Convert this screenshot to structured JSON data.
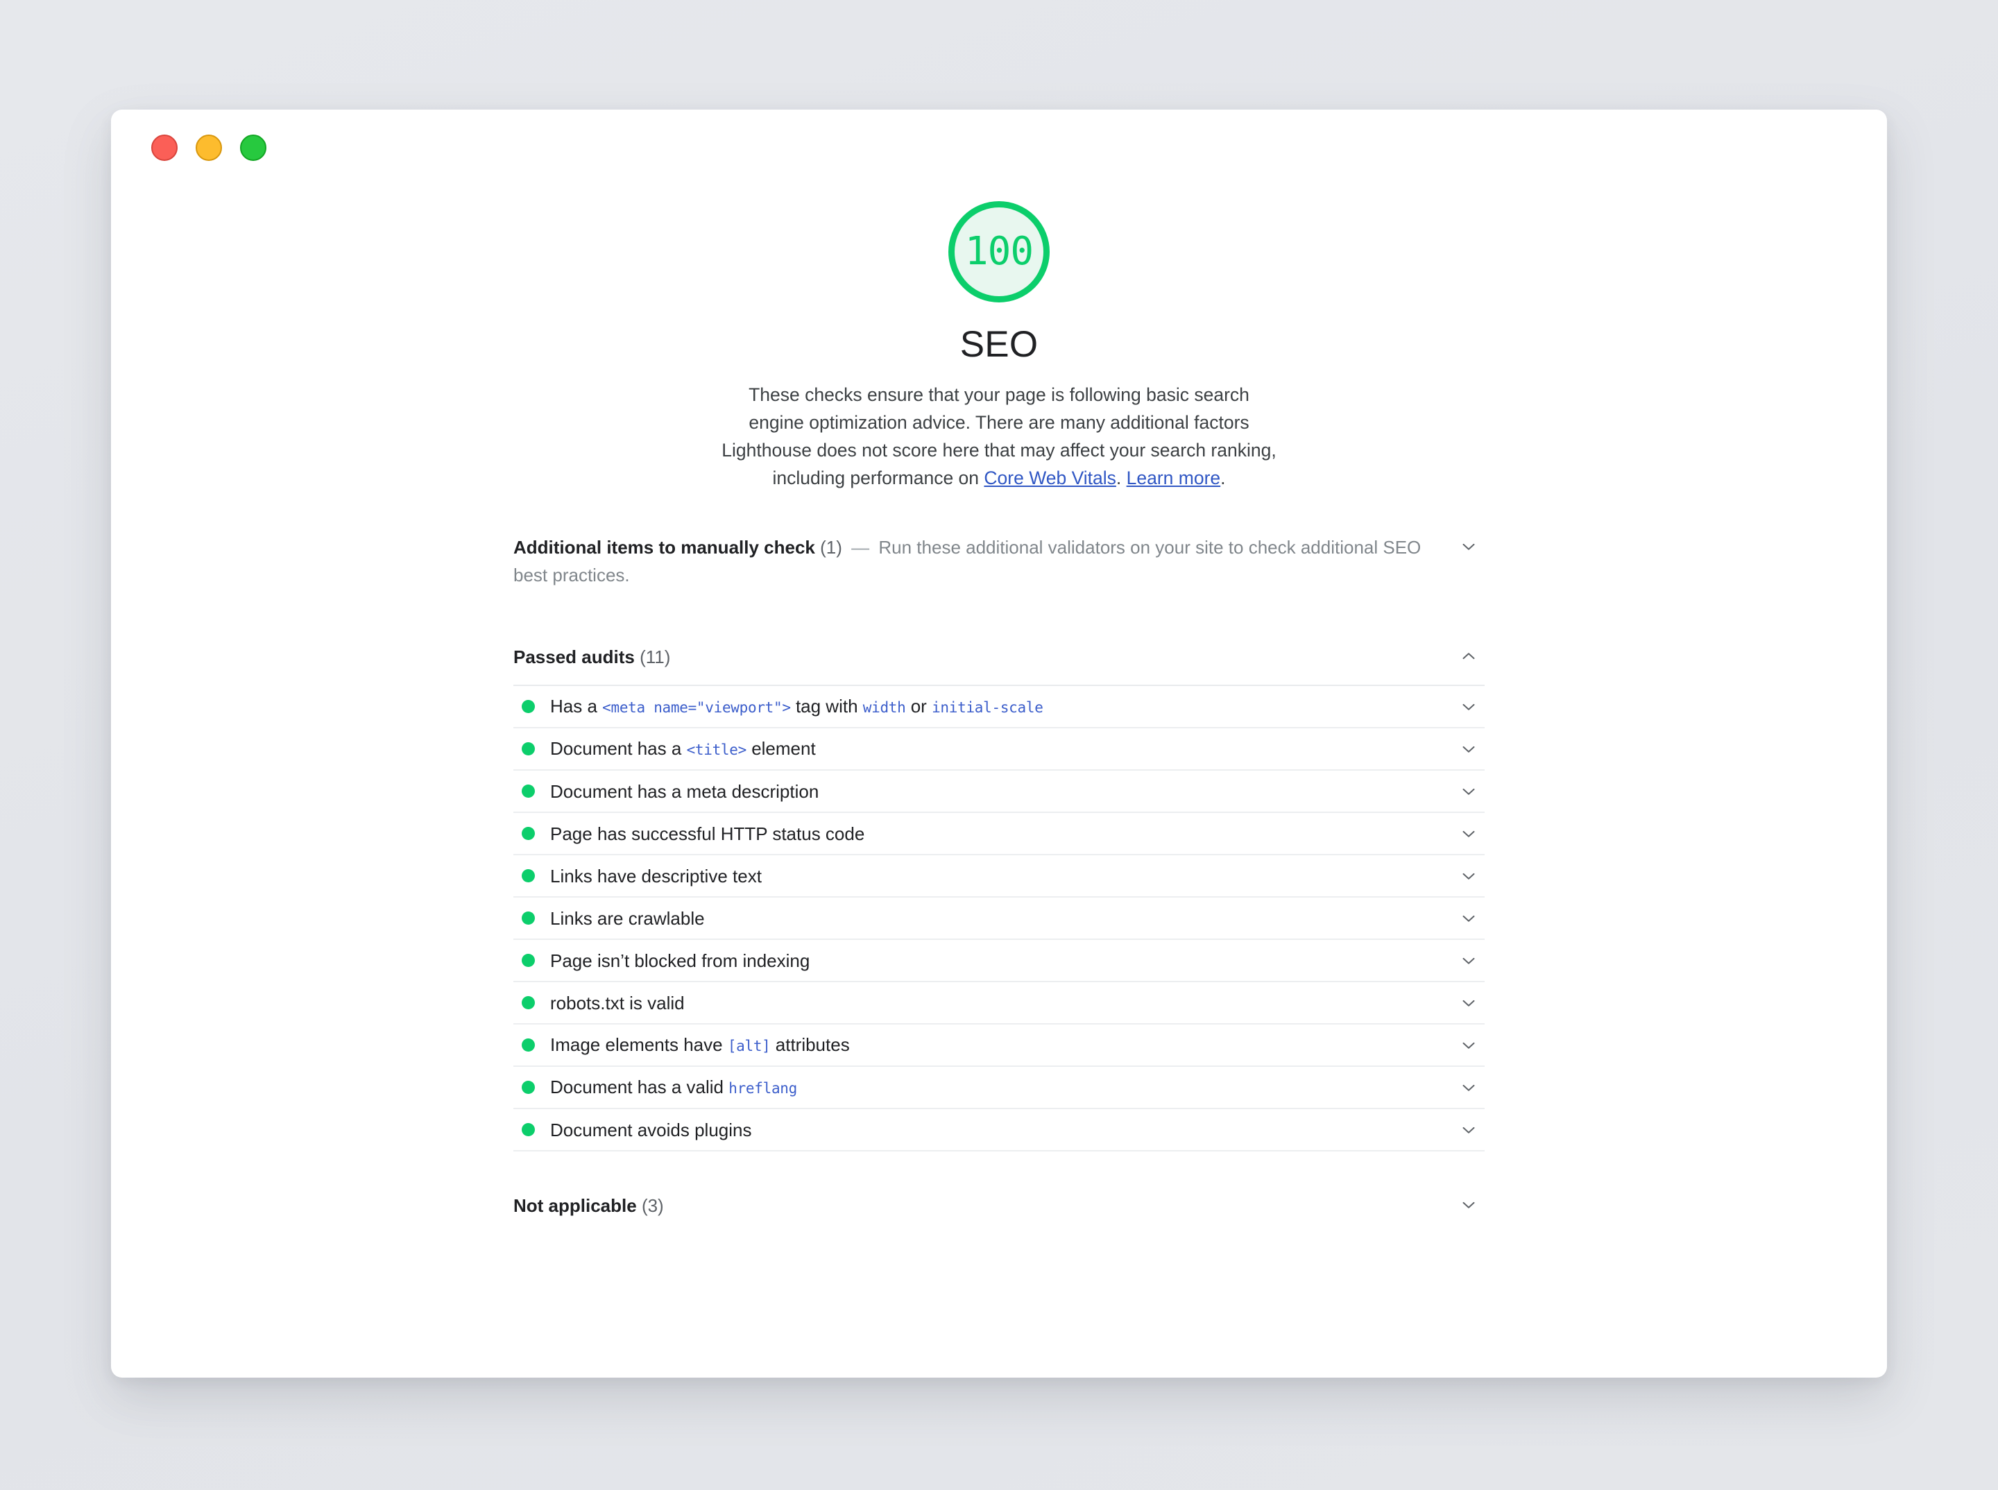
{
  "window": {
    "traffic_lights": [
      {
        "name": "close",
        "color": "#fb5f57"
      },
      {
        "name": "minimize",
        "color": "#fdbc2e"
      },
      {
        "name": "maximize",
        "color": "#27c93f"
      }
    ]
  },
  "report": {
    "score": "100",
    "category_title": "SEO",
    "description_parts": {
      "text_1": "These checks ensure that your page is following basic search engine optimization advice. There are many additional factors Lighthouse does not score here that may affect your search ranking, including performance on ",
      "link_1": "Core Web Vitals",
      "text_2": ". ",
      "link_2": "Learn more",
      "text_3": "."
    },
    "colors": {
      "pass_green": "#0cce6b",
      "gauge_fill": "#e8f7ef",
      "link_blue": "#3057c4",
      "code_blue": "#3c5ecb"
    }
  },
  "sections": {
    "manual": {
      "title": "Additional items to manually check",
      "count": "(1)",
      "dash": "—",
      "description": "Run these additional validators on your site to check additional SEO best practices.",
      "chevron": "chevron-down-icon",
      "expanded": false
    },
    "passed": {
      "title": "Passed audits",
      "count": "(11)",
      "chevron": "chevron-up-icon",
      "expanded": true
    },
    "not_applicable": {
      "title": "Not applicable",
      "count": "(3)",
      "chevron": "chevron-down-icon",
      "expanded": false
    }
  },
  "audits": [
    {
      "segments": [
        {
          "type": "text",
          "value": "Has a "
        },
        {
          "type": "code",
          "value": "<meta name=\"viewport\">"
        },
        {
          "type": "text",
          "value": " tag with "
        },
        {
          "type": "code",
          "value": "width"
        },
        {
          "type": "text",
          "value": " or "
        },
        {
          "type": "code",
          "value": "initial-scale"
        }
      ],
      "status": "pass"
    },
    {
      "segments": [
        {
          "type": "text",
          "value": "Document has a "
        },
        {
          "type": "code",
          "value": "<title>"
        },
        {
          "type": "text",
          "value": " element"
        }
      ],
      "status": "pass"
    },
    {
      "segments": [
        {
          "type": "text",
          "value": "Document has a meta description"
        }
      ],
      "status": "pass"
    },
    {
      "segments": [
        {
          "type": "text",
          "value": "Page has successful HTTP status code"
        }
      ],
      "status": "pass"
    },
    {
      "segments": [
        {
          "type": "text",
          "value": "Links have descriptive text"
        }
      ],
      "status": "pass"
    },
    {
      "segments": [
        {
          "type": "text",
          "value": "Links are crawlable"
        }
      ],
      "status": "pass"
    },
    {
      "segments": [
        {
          "type": "text",
          "value": "Page isn’t blocked from indexing"
        }
      ],
      "status": "pass"
    },
    {
      "segments": [
        {
          "type": "text",
          "value": "robots.txt is valid"
        }
      ],
      "status": "pass"
    },
    {
      "segments": [
        {
          "type": "text",
          "value": "Image elements have "
        },
        {
          "type": "code",
          "value": "[alt]"
        },
        {
          "type": "text",
          "value": " attributes"
        }
      ],
      "status": "pass"
    },
    {
      "segments": [
        {
          "type": "text",
          "value": "Document has a valid "
        },
        {
          "type": "code",
          "value": "hreflang"
        }
      ],
      "status": "pass"
    },
    {
      "segments": [
        {
          "type": "text",
          "value": "Document avoids plugins"
        }
      ],
      "status": "pass"
    }
  ]
}
